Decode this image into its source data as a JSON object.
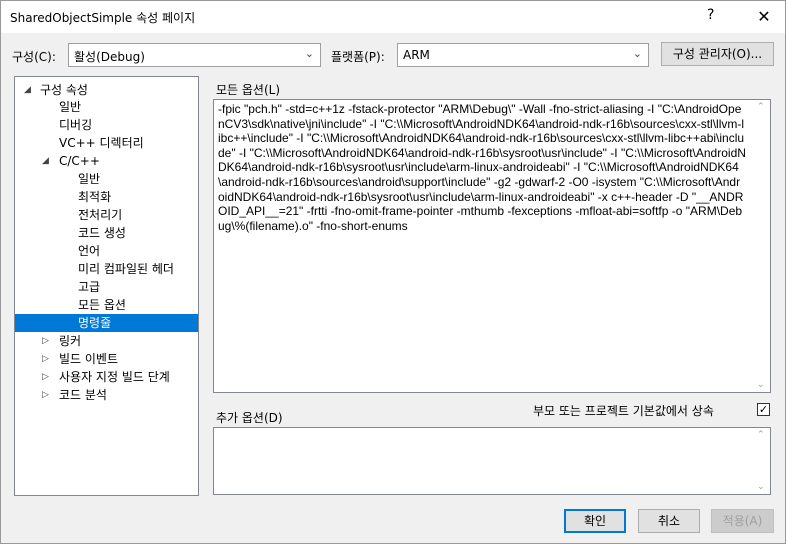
{
  "window": {
    "title": "SharedObjectSimple 속성 페이지",
    "help_glyph": "?",
    "close_glyph": "✕"
  },
  "config": {
    "label": "구성(C):",
    "value": "활성(Debug)"
  },
  "platform": {
    "label": "플랫폼(P):",
    "value": "ARM"
  },
  "config_manager_label": "구성 관리자(O)...",
  "tree": {
    "root": "구성 속성",
    "general": "일반",
    "debugging": "디버깅",
    "vc_dirs": "VC++ 디렉터리",
    "cpp": "C/C++",
    "cpp_general": "일반",
    "cpp_opt": "최적화",
    "cpp_pre": "전처리기",
    "cpp_codegen": "코드 생성",
    "cpp_lang": "언어",
    "cpp_pch": "미리 컴파일된 헤더",
    "cpp_adv": "고급",
    "cpp_all": "모든 옵션",
    "cpp_cmd": "명령줄",
    "linker": "링커",
    "build_events": "빌드 이벤트",
    "custom_build": "사용자 지정 빌드 단계",
    "code_analysis": "코드 분석"
  },
  "all_options": {
    "label": "모든 옵션(L)",
    "text": "-fpic \"pch.h\" -std=c++1z -fstack-protector \"ARM\\Debug\\\" -Wall -fno-strict-aliasing -I \"C:\\AndroidOpenCV3\\sdk\\native\\jni\\include\" -I \"C:\\\\Microsoft\\AndroidNDK64\\android-ndk-r16b\\sources\\cxx-stl\\llvm-libc++\\include\" -I \"C:\\\\Microsoft\\AndroidNDK64\\android-ndk-r16b\\sources\\cxx-stl\\llvm-libc++abi\\include\" -I \"C:\\\\Microsoft\\AndroidNDK64\\android-ndk-r16b\\sysroot\\usr\\include\" -I \"C:\\\\Microsoft\\AndroidNDK64\\android-ndk-r16b\\sysroot\\usr\\include\\arm-linux-androideabi\" -I \"C:\\\\Microsoft\\AndroidNDK64\\android-ndk-r16b\\sources\\android\\support\\include\" -g2 -gdwarf-2 -O0 -isystem \"C:\\\\Microsoft\\AndroidNDK64\\android-ndk-r16b\\sysroot\\usr\\include\\arm-linux-androideabi\" -x c++-header -D \"__ANDROID_API__=21\" -frtti -fno-omit-frame-pointer -mthumb -fexceptions -mfloat-abi=softfp -o \"ARM\\Debug\\%(filename).o\" -fno-short-enums"
  },
  "additional_options": {
    "label": "추가 옵션(D)",
    "value": ""
  },
  "inherit": {
    "label": "부모 또는 프로젝트 기본값에서 상속",
    "checked": true,
    "check_glyph": "✓"
  },
  "buttons": {
    "ok": "확인",
    "cancel": "취소",
    "apply": "적용(A)"
  }
}
